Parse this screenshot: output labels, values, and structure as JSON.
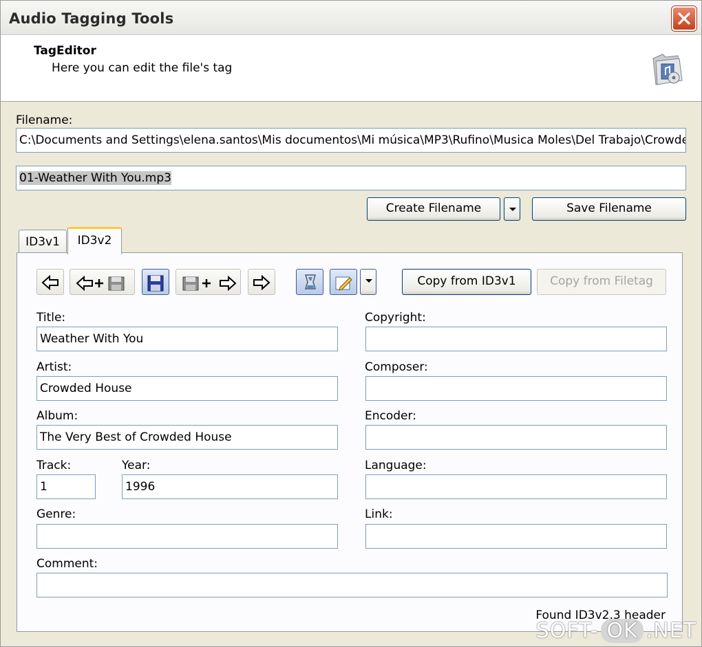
{
  "window": {
    "title": "Audio Tagging Tools"
  },
  "header": {
    "title": "TagEditor",
    "subtitle": "Here you can edit the file's tag",
    "icon": "music-folder-icon"
  },
  "filename_section": {
    "label": "Filename:",
    "path": "C:\\Documents and Settings\\elena.santos\\Mis documentos\\Mi música\\MP3\\Rufino\\Musica Moles\\Del Trabajo\\Crowde",
    "file": "01-Weather With You.mp3",
    "create_label": "Create Filename",
    "save_label": "Save Filename"
  },
  "tabs": [
    {
      "label": "ID3v1"
    },
    {
      "label": "ID3v2",
      "active": true
    }
  ],
  "toolbar": {
    "icons": [
      "arrow-left-icon",
      "arrow-left-save-icon",
      "save-icon",
      "save-arrow-right-icon",
      "arrow-right-icon",
      "erase-icon",
      "edit-icon"
    ],
    "copy_id3v1": "Copy from ID3v1",
    "copy_filetag": "Copy from Filetag"
  },
  "fields": {
    "title": {
      "label": "Title:",
      "value": "Weather With You"
    },
    "artist": {
      "label": "Artist:",
      "value": "Crowded House"
    },
    "album": {
      "label": "Album:",
      "value": "The Very Best of Crowded House"
    },
    "track": {
      "label": "Track:",
      "value": "1"
    },
    "year": {
      "label": "Year:",
      "value": "1996"
    },
    "genre": {
      "label": "Genre:",
      "value": ""
    },
    "comment": {
      "label": "Comment:",
      "value": ""
    },
    "copyright": {
      "label": "Copyright:",
      "value": ""
    },
    "composer": {
      "label": "Composer:",
      "value": ""
    },
    "encoder": {
      "label": "Encoder:",
      "value": ""
    },
    "language": {
      "label": "Language:",
      "value": ""
    },
    "link": {
      "label": "Link:",
      "value": ""
    }
  },
  "status": "Found ID3v2.3 header",
  "watermark": {
    "left": "SOFT-",
    "mid": "OK",
    "right": ".NET"
  },
  "colors": {
    "accent_tab": "#ffc83c",
    "button_border": "#003c74",
    "field_border": "#7f9db9",
    "close_button": "#c4401c"
  }
}
